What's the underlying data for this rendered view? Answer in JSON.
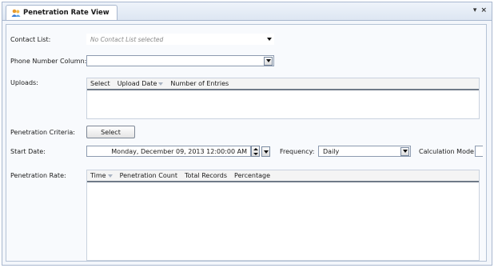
{
  "tab": {
    "title": "Penetration Rate View",
    "icon": "users-icon"
  },
  "window_controls": {
    "pin": "▾",
    "close": "×"
  },
  "form": {
    "contact_list": {
      "label": "Contact List:",
      "placeholder": "No Contact List selected"
    },
    "phone_column": {
      "label": "Phone Number Column:",
      "value": ""
    },
    "uploads": {
      "label": "Uploads:",
      "columns": [
        "Select",
        "Upload Date",
        "Number of Entries"
      ]
    },
    "criteria": {
      "label": "Penetration Criteria:",
      "button": "Select"
    },
    "start_date": {
      "label": "Start Date:",
      "value": "Monday, December 09, 2013 12:00:00 AM"
    },
    "frequency": {
      "label": "Frequency:",
      "value": "Daily"
    },
    "calc_mode": {
      "label": "Calculation Mode:"
    },
    "rate": {
      "label": "Penetration Rate:",
      "columns": [
        "Time",
        "Penetration Count",
        "Total Records",
        "Percentage"
      ]
    }
  }
}
